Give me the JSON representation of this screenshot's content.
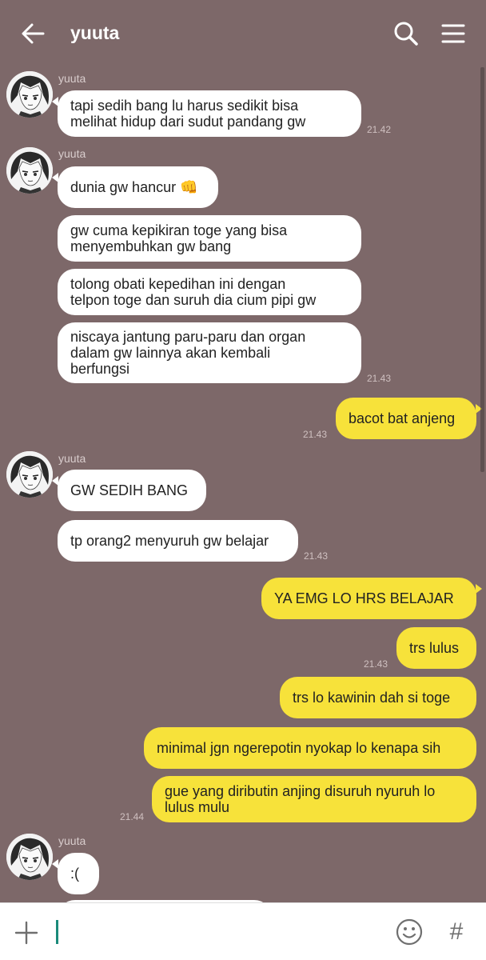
{
  "header": {
    "title": "yuuta"
  },
  "contact": {
    "name": "yuuta"
  },
  "messages": {
    "m1": {
      "text1": "tapi sedih bang lu harus sedikit bisa",
      "text2": "melihat hidup dari sudut pandang gw",
      "time": "21.42"
    },
    "m2": {
      "text": "dunia gw hancur 👊"
    },
    "m3": {
      "text1": "gw cuma kepikiran toge yang bisa",
      "text2": "menyembuhkan gw bang"
    },
    "m4": {
      "text1": "tolong obati kepedihan ini dengan",
      "text2": "telpon toge dan suruh dia cium pipi gw"
    },
    "m5": {
      "text1": "niscaya jantung paru-paru dan organ",
      "text2": "dalam gw lainnya akan kembali",
      "text3": "berfungsi",
      "time": "21.43"
    },
    "m6": {
      "text": "bacot bat anjeng",
      "time": "21.43"
    },
    "m7": {
      "text": "GW SEDIH BANG"
    },
    "m8": {
      "text": "tp orang2 menyuruh gw belajar",
      "time": "21.43"
    },
    "m9": {
      "text": "YA EMG LO HRS BELAJAR"
    },
    "m10": {
      "text": "trs lulus",
      "time": "21.43"
    },
    "m11": {
      "text": "trs lo kawinin dah si toge"
    },
    "m12": {
      "text": "minimal jgn ngerepotin nyokap lo kenapa sih"
    },
    "m13": {
      "text1": "gue yang diributin anjing disuruh nyuruh lo",
      "text2": "lulus mulu",
      "time": "21.44"
    },
    "m14": {
      "text": ":("
    }
  },
  "input": {
    "placeholder": "",
    "value": ""
  },
  "icons": {
    "back": "arrow-left-icon",
    "search": "search-icon",
    "menu": "menu-icon",
    "add": "plus-icon",
    "emoji": "smiley-icon",
    "hashtag": "hash-icon"
  },
  "colors": {
    "background": "#7d6869",
    "incoming": "#ffffff",
    "outgoing": "#f7e23a",
    "accent": "#1a8a7a"
  }
}
